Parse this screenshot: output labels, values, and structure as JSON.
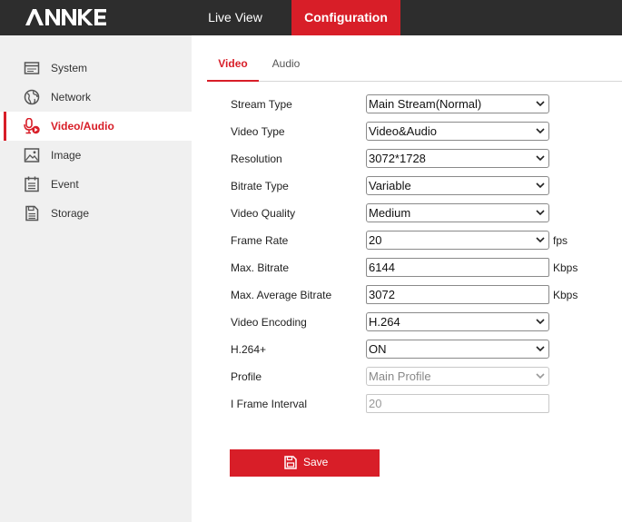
{
  "header": {
    "logo_text": "ANNKE",
    "nav": {
      "live_view": "Live View",
      "configuration": "Configuration"
    }
  },
  "sidebar": {
    "items": [
      {
        "label": "System",
        "icon": "system-icon"
      },
      {
        "label": "Network",
        "icon": "network-icon"
      },
      {
        "label": "Video/Audio",
        "icon": "video-audio-icon",
        "active": true
      },
      {
        "label": "Image",
        "icon": "image-icon"
      },
      {
        "label": "Event",
        "icon": "event-icon"
      },
      {
        "label": "Storage",
        "icon": "storage-icon"
      }
    ]
  },
  "tabs": {
    "video": "Video",
    "audio": "Audio"
  },
  "form": {
    "stream_type": {
      "label": "Stream Type",
      "value": "Main Stream(Normal)"
    },
    "video_type": {
      "label": "Video Type",
      "value": "Video&Audio"
    },
    "resolution": {
      "label": "Resolution",
      "value": "3072*1728"
    },
    "bitrate_type": {
      "label": "Bitrate Type",
      "value": "Variable"
    },
    "video_quality": {
      "label": "Video Quality",
      "value": "Medium"
    },
    "frame_rate": {
      "label": "Frame Rate",
      "value": "20",
      "unit": "fps"
    },
    "max_bitrate": {
      "label": "Max. Bitrate",
      "value": "6144",
      "unit": "Kbps"
    },
    "max_avg_bitrate": {
      "label": "Max. Average Bitrate",
      "value": "3072",
      "unit": "Kbps"
    },
    "video_encoding": {
      "label": "Video Encoding",
      "value": "H.264"
    },
    "h264_plus": {
      "label": "H.264+",
      "value": "ON"
    },
    "profile": {
      "label": "Profile",
      "value": "Main Profile"
    },
    "i_frame_interval": {
      "label": "I Frame Interval",
      "value": "20"
    }
  },
  "actions": {
    "save_label": "Save"
  },
  "colors": {
    "accent": "#d81e28",
    "topbar": "#2d2d2d",
    "sidebar": "#f0f0f0"
  }
}
